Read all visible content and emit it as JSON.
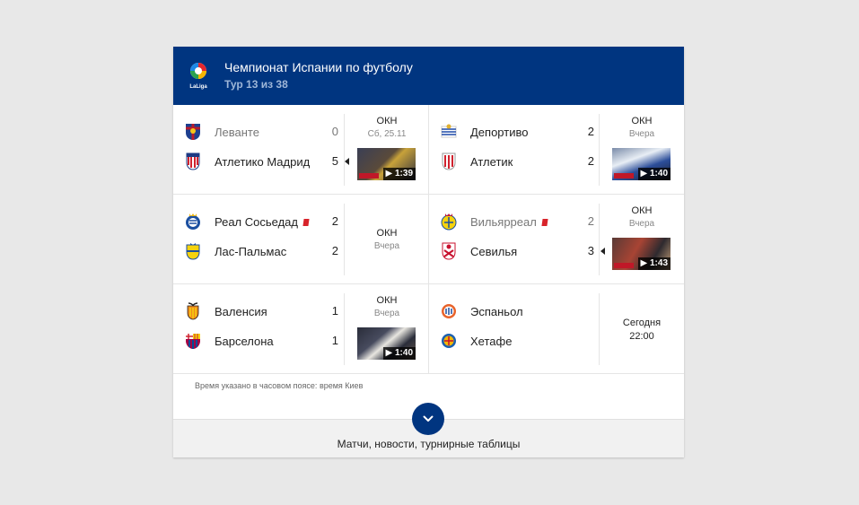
{
  "header": {
    "title": "Чемпионат Испании по футболу",
    "subtitle": "Тур 13 из 38",
    "logo_text": "LaLiga"
  },
  "matches": [
    {
      "home": {
        "name": "Леванте",
        "score": "0",
        "lost": true,
        "crest": "levante-crest"
      },
      "away": {
        "name": "Атлетико Мадрид",
        "score": "5",
        "lost": false,
        "crest": "atletico-crest",
        "winner_arrow": true
      },
      "status": "ОКН",
      "date": "Сб, 25.11",
      "video": "1:39"
    },
    {
      "home": {
        "name": "Депортиво",
        "score": "2",
        "lost": false,
        "crest": "deportivo-crest"
      },
      "away": {
        "name": "Атлетик",
        "score": "2",
        "lost": false,
        "crest": "athletic-crest"
      },
      "status": "ОКН",
      "date": "Вчера",
      "video": "1:40"
    },
    {
      "home": {
        "name": "Реал Сосьедад",
        "score": "2",
        "lost": false,
        "crest": "real-sociedad-crest",
        "red_card": true
      },
      "away": {
        "name": "Лас-Пальмас",
        "score": "2",
        "lost": false,
        "crest": "las-palmas-crest"
      },
      "status": "ОКН",
      "date": "Вчера",
      "video": ""
    },
    {
      "home": {
        "name": "Вильярреал",
        "score": "2",
        "lost": true,
        "crest": "villarreal-crest",
        "red_card": true
      },
      "away": {
        "name": "Севилья",
        "score": "3",
        "lost": false,
        "crest": "sevilla-crest",
        "winner_arrow": true
      },
      "status": "ОКН",
      "date": "Вчера",
      "video": "1:43"
    },
    {
      "home": {
        "name": "Валенсия",
        "score": "1",
        "lost": false,
        "crest": "valencia-crest"
      },
      "away": {
        "name": "Барселона",
        "score": "1",
        "lost": false,
        "crest": "barcelona-crest"
      },
      "status": "ОКН",
      "date": "Вчера",
      "video": "1:40"
    },
    {
      "home": {
        "name": "Эспаньол",
        "score": "",
        "lost": false,
        "crest": "espanyol-crest"
      },
      "away": {
        "name": "Хетафе",
        "score": "",
        "lost": false,
        "crest": "getafe-crest"
      },
      "status": "Сегодня",
      "date": "22:00",
      "video": ""
    }
  ],
  "timezone_note": "Время указано в часовом поясе: время Киев",
  "footer": {
    "label": "Матчи, новости, турнирные таблицы"
  },
  "colors": {
    "header_bg": "#003580",
    "accent": "#003580",
    "red_card": "#d8232a"
  }
}
